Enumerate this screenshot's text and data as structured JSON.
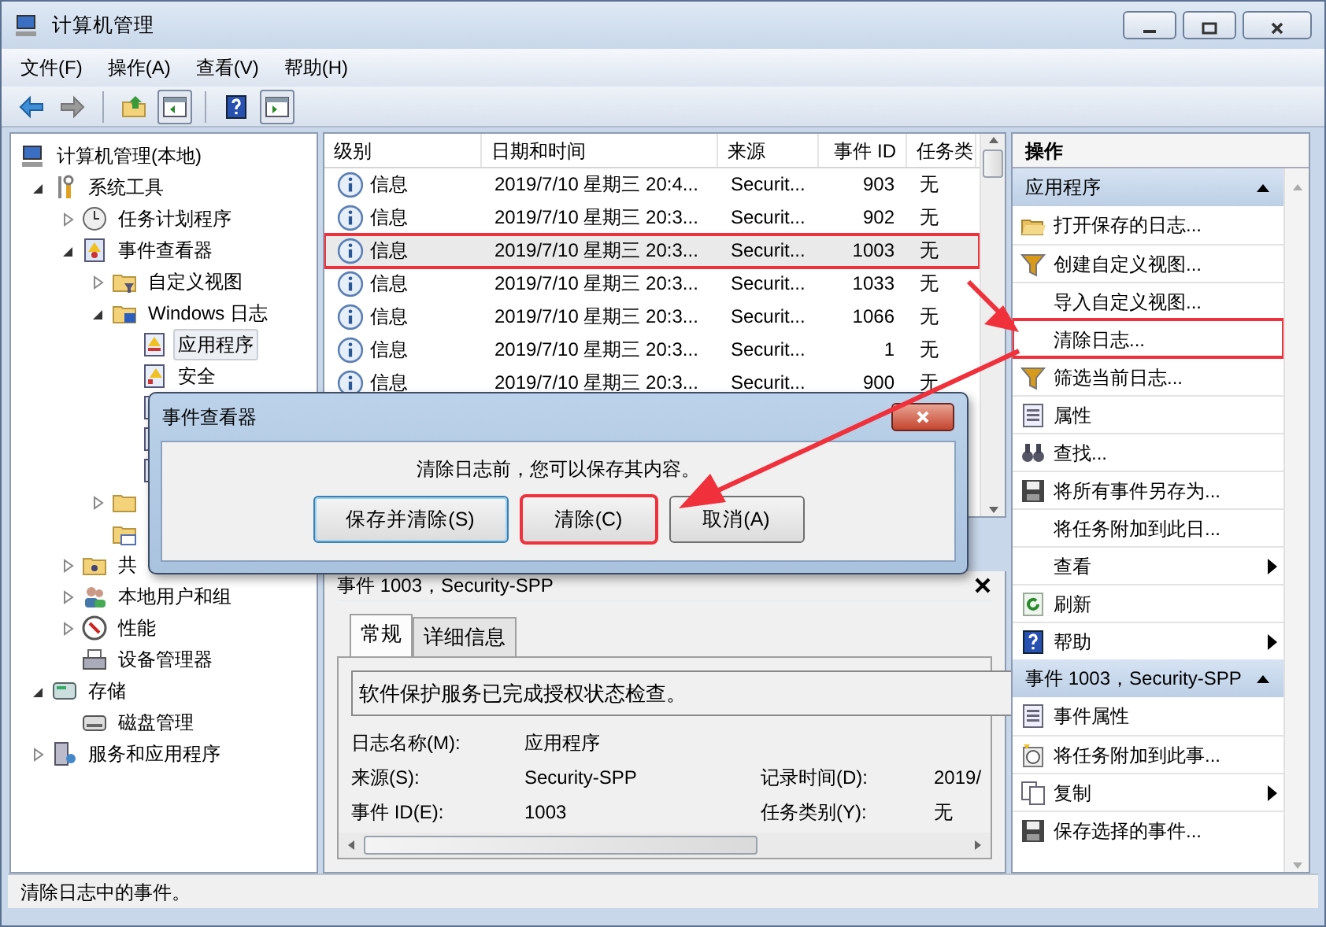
{
  "window": {
    "title": "计算机管理"
  },
  "menu": [
    "文件(F)",
    "操作(A)",
    "查看(V)",
    "帮助(H)"
  ],
  "toolbar": [
    {
      "kind": "back",
      "pressed": false
    },
    {
      "kind": "forward",
      "pressed": false
    },
    {
      "kind": "sep"
    },
    {
      "kind": "up",
      "pressed": false
    },
    {
      "kind": "pane-left",
      "pressed": true
    },
    {
      "kind": "sep"
    },
    {
      "kind": "help",
      "pressed": false
    },
    {
      "kind": "pane-right",
      "pressed": true
    }
  ],
  "tree": [
    {
      "label": "计算机管理(本地)",
      "kind": "computer",
      "children": [
        {
          "label": "系统工具",
          "kind": "tools",
          "expanded": true,
          "children": [
            {
              "label": "任务计划程序",
              "kind": "clock",
              "expanded": false
            },
            {
              "label": "事件查看器",
              "kind": "eventlog",
              "expanded": true,
              "children": [
                {
                  "label": "自定义视图",
                  "kind": "folder-filter",
                  "expanded": false
                },
                {
                  "label": "Windows 日志",
                  "kind": "folder-win",
                  "expanded": true,
                  "children": [
                    {
                      "label": "应用程序",
                      "kind": "log-app",
                      "selected": true
                    },
                    {
                      "label": "安全",
                      "kind": "log",
                      "selected": false
                    },
                    {
                      "kind": "log"
                    },
                    {
                      "kind": "log"
                    },
                    {
                      "kind": "log"
                    }
                  ]
                },
                {
                  "kind": "folder",
                  "expanded": false
                },
                {
                  "kind": "folder-cal"
                }
              ]
            },
            {
              "label": "共",
              "kind": "share",
              "expanded": false
            },
            {
              "label": "本地用户和组",
              "kind": "users",
              "expanded": false
            },
            {
              "label": "性能",
              "kind": "perf",
              "expanded": false
            },
            {
              "label": "设备管理器",
              "kind": "device"
            }
          ]
        },
        {
          "label": "存储",
          "kind": "storage",
          "expanded": true,
          "children": [
            {
              "label": "磁盘管理",
              "kind": "disk"
            }
          ]
        },
        {
          "label": "服务和应用程序",
          "kind": "services",
          "expanded": false
        }
      ]
    }
  ],
  "events": {
    "columns": [
      "级别",
      "日期和时间",
      "来源",
      "事件 ID",
      "任务类"
    ],
    "rows": [
      {
        "level": "信息",
        "date": "2019/7/10 星期三 20:4...",
        "source": "Securit...",
        "event_id": "903",
        "task": "无",
        "selected": false,
        "highlighted": false
      },
      {
        "level": "信息",
        "date": "2019/7/10 星期三 20:3...",
        "source": "Securit...",
        "event_id": "902",
        "task": "无",
        "selected": false,
        "highlighted": false
      },
      {
        "level": "信息",
        "date": "2019/7/10 星期三 20:3...",
        "source": "Securit...",
        "event_id": "1003",
        "task": "无",
        "selected": true,
        "highlighted": true
      },
      {
        "level": "信息",
        "date": "2019/7/10 星期三 20:3...",
        "source": "Securit...",
        "event_id": "1033",
        "task": "无",
        "selected": false,
        "highlighted": false
      },
      {
        "level": "信息",
        "date": "2019/7/10 星期三 20:3...",
        "source": "Securit...",
        "event_id": "1066",
        "task": "无",
        "selected": false,
        "highlighted": false
      },
      {
        "level": "信息",
        "date": "2019/7/10 星期三 20:3...",
        "source": "Securit...",
        "event_id": "1",
        "task": "无",
        "selected": false,
        "highlighted": false
      },
      {
        "level": "信息",
        "date": "2019/7/10 星期三 20:3...",
        "source": "Securit...",
        "event_id": "900",
        "task": "无",
        "selected": false,
        "highlighted": false
      }
    ]
  },
  "detail": {
    "title": "事件 1003，Security-SPP",
    "tabs": [
      {
        "label": "常规",
        "selected": true
      },
      {
        "label": "详细信息",
        "selected": false
      }
    ],
    "description": "软件保护服务已完成授权状态检查。",
    "rows": [
      [
        {
          "label": "日志名称(M):",
          "value": "应用程序"
        }
      ],
      [
        {
          "label": "来源(S):",
          "value": "Security-SPP"
        },
        {
          "label": "记录时间(D):",
          "value": "2019/"
        }
      ],
      [
        {
          "label": "事件 ID(E):",
          "value": "1003"
        },
        {
          "label": "任务类别(Y):",
          "value": "无"
        }
      ]
    ]
  },
  "actions": {
    "title": "操作",
    "sections": [
      {
        "title": "应用程序",
        "expanded": true,
        "items": [
          {
            "label": "打开保存的日志...",
            "kind": "folder-open"
          },
          {
            "label": "创建自定义视图...",
            "kind": "filter"
          },
          {
            "label": "导入自定义视图..."
          },
          {
            "label": "清除日志...",
            "highlighted": true
          },
          {
            "label": "筛选当前日志...",
            "kind": "filter"
          },
          {
            "label": "属性",
            "kind": "props"
          },
          {
            "label": "查找...",
            "kind": "find"
          },
          {
            "label": "将所有事件另存为...",
            "kind": "save"
          },
          {
            "label": "将任务附加到此日..."
          },
          {
            "label": "查看",
            "submenu": true
          },
          {
            "label": "刷新",
            "kind": "refresh"
          },
          {
            "label": "帮助",
            "kind": "help",
            "submenu": true
          }
        ]
      },
      {
        "title": "事件 1003，Security-SPP",
        "expanded": true,
        "items": [
          {
            "label": "事件属性",
            "kind": "props"
          },
          {
            "label": "将任务附加到此事...",
            "kind": "task"
          },
          {
            "label": "复制",
            "kind": "copy",
            "submenu": true
          },
          {
            "label": "保存选择的事件...",
            "kind": "save"
          }
        ]
      }
    ]
  },
  "dialog": {
    "title": "事件查看器",
    "message": "清除日志前，您可以保存其内容。",
    "buttons": [
      {
        "label": "保存并清除(S)",
        "default": true,
        "highlighted": false
      },
      {
        "label": "清除(C)",
        "default": false,
        "highlighted": true
      },
      {
        "label": "取消(A)",
        "default": false,
        "highlighted": false
      }
    ]
  },
  "status_bar": "清除日志中的事件。"
}
